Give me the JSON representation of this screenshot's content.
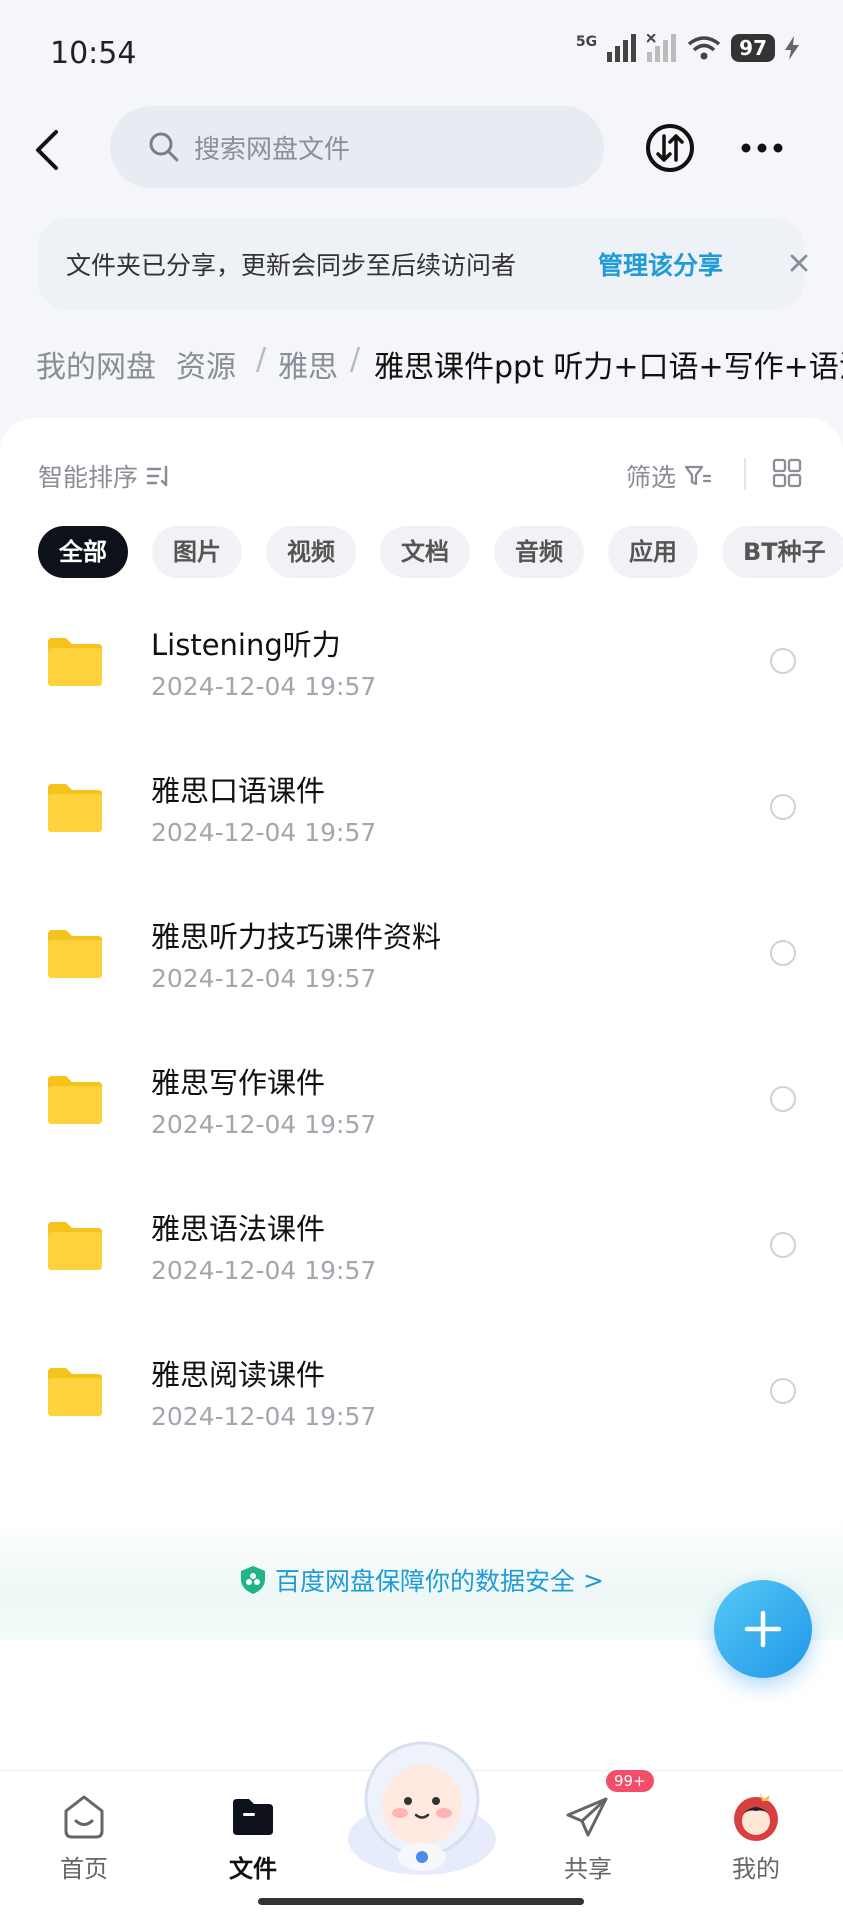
{
  "status": {
    "time": "10:54",
    "network": "5G",
    "battery": "97"
  },
  "header": {
    "search_placeholder": "搜索网盘文件",
    "back_icon": "chevron-left-icon",
    "transfer_icon": "transfer-icon",
    "more_icon": "more-horizontal-icon"
  },
  "share_banner": {
    "text": "文件夹已分享，更新会同步至后续访问者",
    "manage_label": "管理该分享",
    "close_icon": "close-icon"
  },
  "breadcrumb": {
    "home": "我的网盘",
    "items": [
      "资源",
      "雅思"
    ],
    "current": "雅思课件ppt 听力+口语+写作+语法",
    "separator": "/"
  },
  "toolbar": {
    "sort_label": "智能排序",
    "filter_label": "筛选"
  },
  "chips": [
    "全部",
    "图片",
    "视频",
    "文档",
    "音频",
    "应用",
    "BT种子"
  ],
  "files": [
    {
      "name": "Listening听力",
      "date": "2024-12-04  19:57"
    },
    {
      "name": "雅思口语课件",
      "date": "2024-12-04  19:57"
    },
    {
      "name": "雅思听力技巧课件资料",
      "date": "2024-12-04  19:57"
    },
    {
      "name": "雅思写作课件",
      "date": "2024-12-04  19:57"
    },
    {
      "name": "雅思语法课件",
      "date": "2024-12-04  19:57"
    },
    {
      "name": "雅思阅读课件",
      "date": "2024-12-04  19:57"
    }
  ],
  "security": {
    "text": "百度网盘保障你的数据安全",
    "chevron": ">"
  },
  "nav": {
    "home": "首页",
    "files": "文件",
    "share": "共享",
    "me": "我的",
    "share_badge": "99+"
  },
  "colors": {
    "accent": "#1e9bd8",
    "folder": "#fdd23c",
    "fab": "#2096e8",
    "badge": "#f44d6a"
  }
}
